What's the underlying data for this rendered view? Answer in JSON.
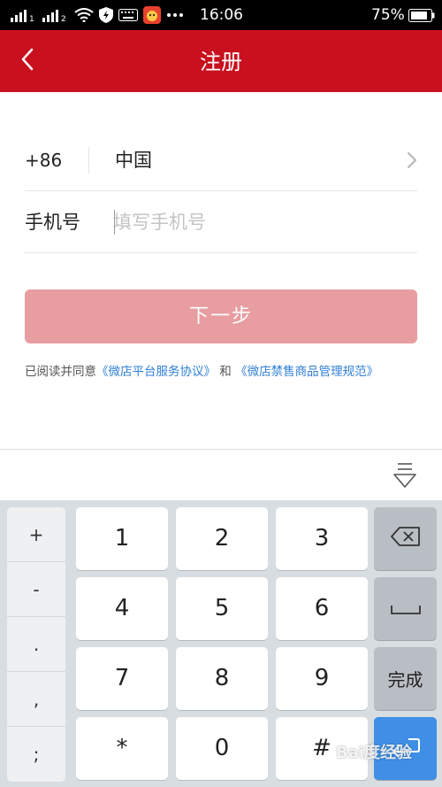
{
  "status_bar": {
    "time": "16:06",
    "battery_percent": "75%",
    "icons": [
      "signal-icon",
      "signal-2-icon",
      "wifi-icon",
      "shield-icon",
      "keyboard-icon",
      "app-notification-icon",
      "more-icon"
    ]
  },
  "header": {
    "title": "注册",
    "back_icon": "chevron-left-icon",
    "background_color": "#c8101e"
  },
  "form": {
    "country_code": "+86",
    "country_name": "中国",
    "phone_label": "手机号",
    "phone_placeholder": "填写手机号",
    "phone_value": ""
  },
  "next_button": {
    "label": "下一步",
    "color": "#e89da1"
  },
  "agreement": {
    "prefix": "已阅读并同意",
    "link1": "《微店平台服务协议》",
    "conjunction": "和",
    "link2": "《微店禁售商品管理规范》",
    "link_color": "#2f7fd6"
  },
  "keyboard": {
    "symbols": [
      "+",
      "-",
      ".",
      ",",
      ";"
    ],
    "digit_keys": [
      "1",
      "2",
      "3",
      "4",
      "5",
      "6",
      "7",
      "8",
      "9",
      "*",
      "0",
      "#"
    ],
    "done_label": "完成",
    "enter_color": "#3f8fe6"
  },
  "watermark": "Bai度经验"
}
